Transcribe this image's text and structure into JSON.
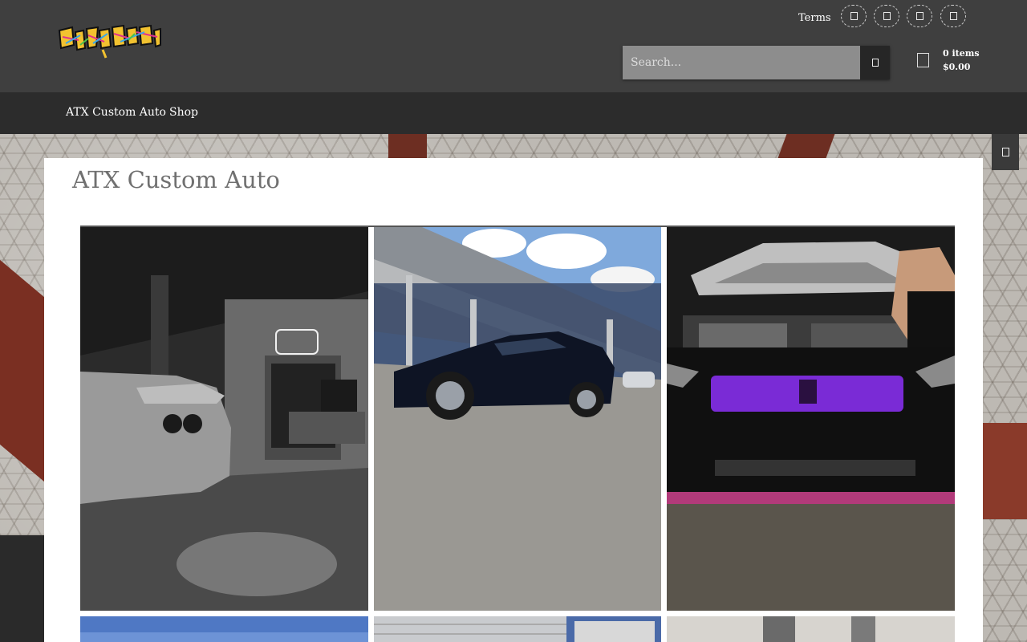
{
  "header": {
    "logo_text": "CustomAuto",
    "terms_link": "Terms",
    "social_icons": [
      "social-icon-1",
      "social-icon-2",
      "social-icon-3",
      "social-icon-4"
    ],
    "search": {
      "placeholder": "Search...",
      "button_icon": "search-icon"
    },
    "cart": {
      "icon": "cart-icon",
      "items": "0 items",
      "total": "$0.00"
    }
  },
  "nav": {
    "items": [
      "ATX Custom Auto",
      "Shop"
    ]
  },
  "corner_button_icon": "toggle-icon",
  "page": {
    "title": "ATX Custom Auto"
  },
  "gallery": {
    "photos": [
      "shop-interior-photo",
      "suv-parking-lot-photo",
      "car-purple-grille-photo",
      "sky-photo",
      "garage-door-photo",
      "garage-ceiling-photo"
    ]
  },
  "colors": {
    "header_bg": "#3f3f3f",
    "nav_bg": "#2c2c2c",
    "search_bg": "#8d8d8d",
    "accent_purple": "#7a2bd6"
  }
}
